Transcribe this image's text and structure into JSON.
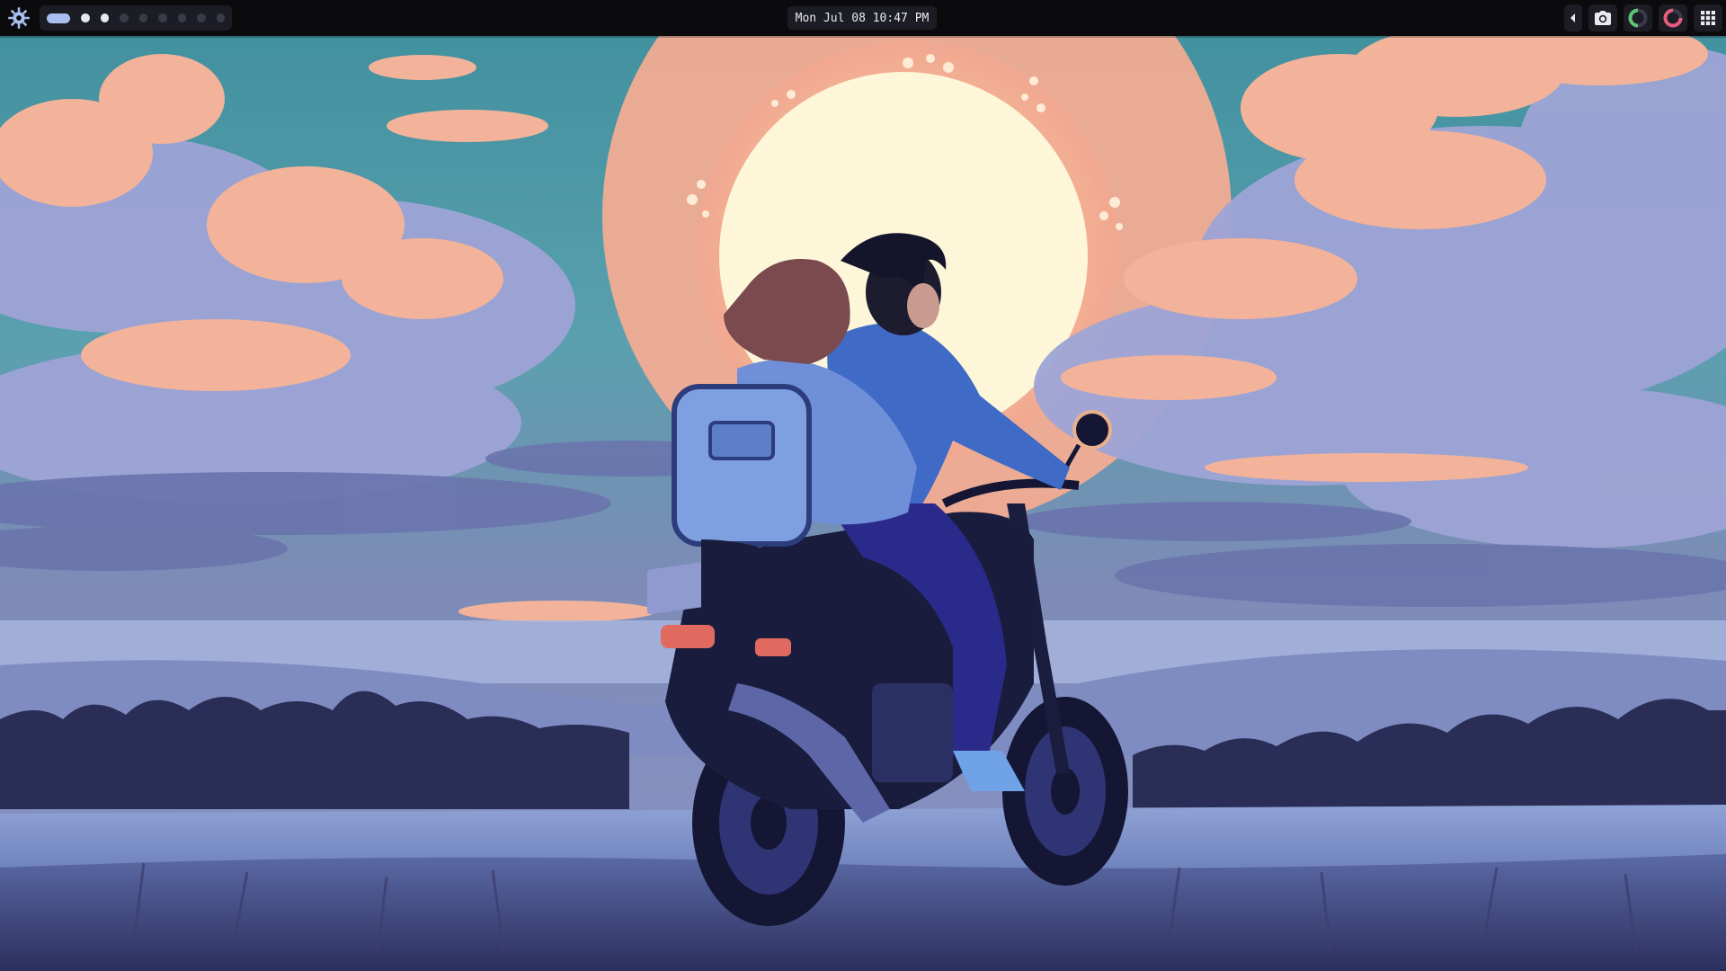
{
  "topbar": {
    "clock": "Mon Jul 08 10:47 PM",
    "workspaces": [
      {
        "state": "active"
      },
      {
        "state": "occupied"
      },
      {
        "state": "occupied"
      },
      {
        "state": "empty"
      },
      {
        "state": "empty"
      },
      {
        "state": "empty"
      },
      {
        "state": "empty"
      },
      {
        "state": "empty"
      },
      {
        "state": "empty"
      }
    ],
    "tray": {
      "collapse_icon": "chevron-left-icon",
      "screenshot_icon": "camera-icon",
      "cpu_ring_color": "#5ec27a",
      "mem_ring_color": "#e45c7c",
      "apps_icon": "grid-icon"
    },
    "launcher_icon": "gear-icon",
    "accent": "#a9bff0"
  }
}
